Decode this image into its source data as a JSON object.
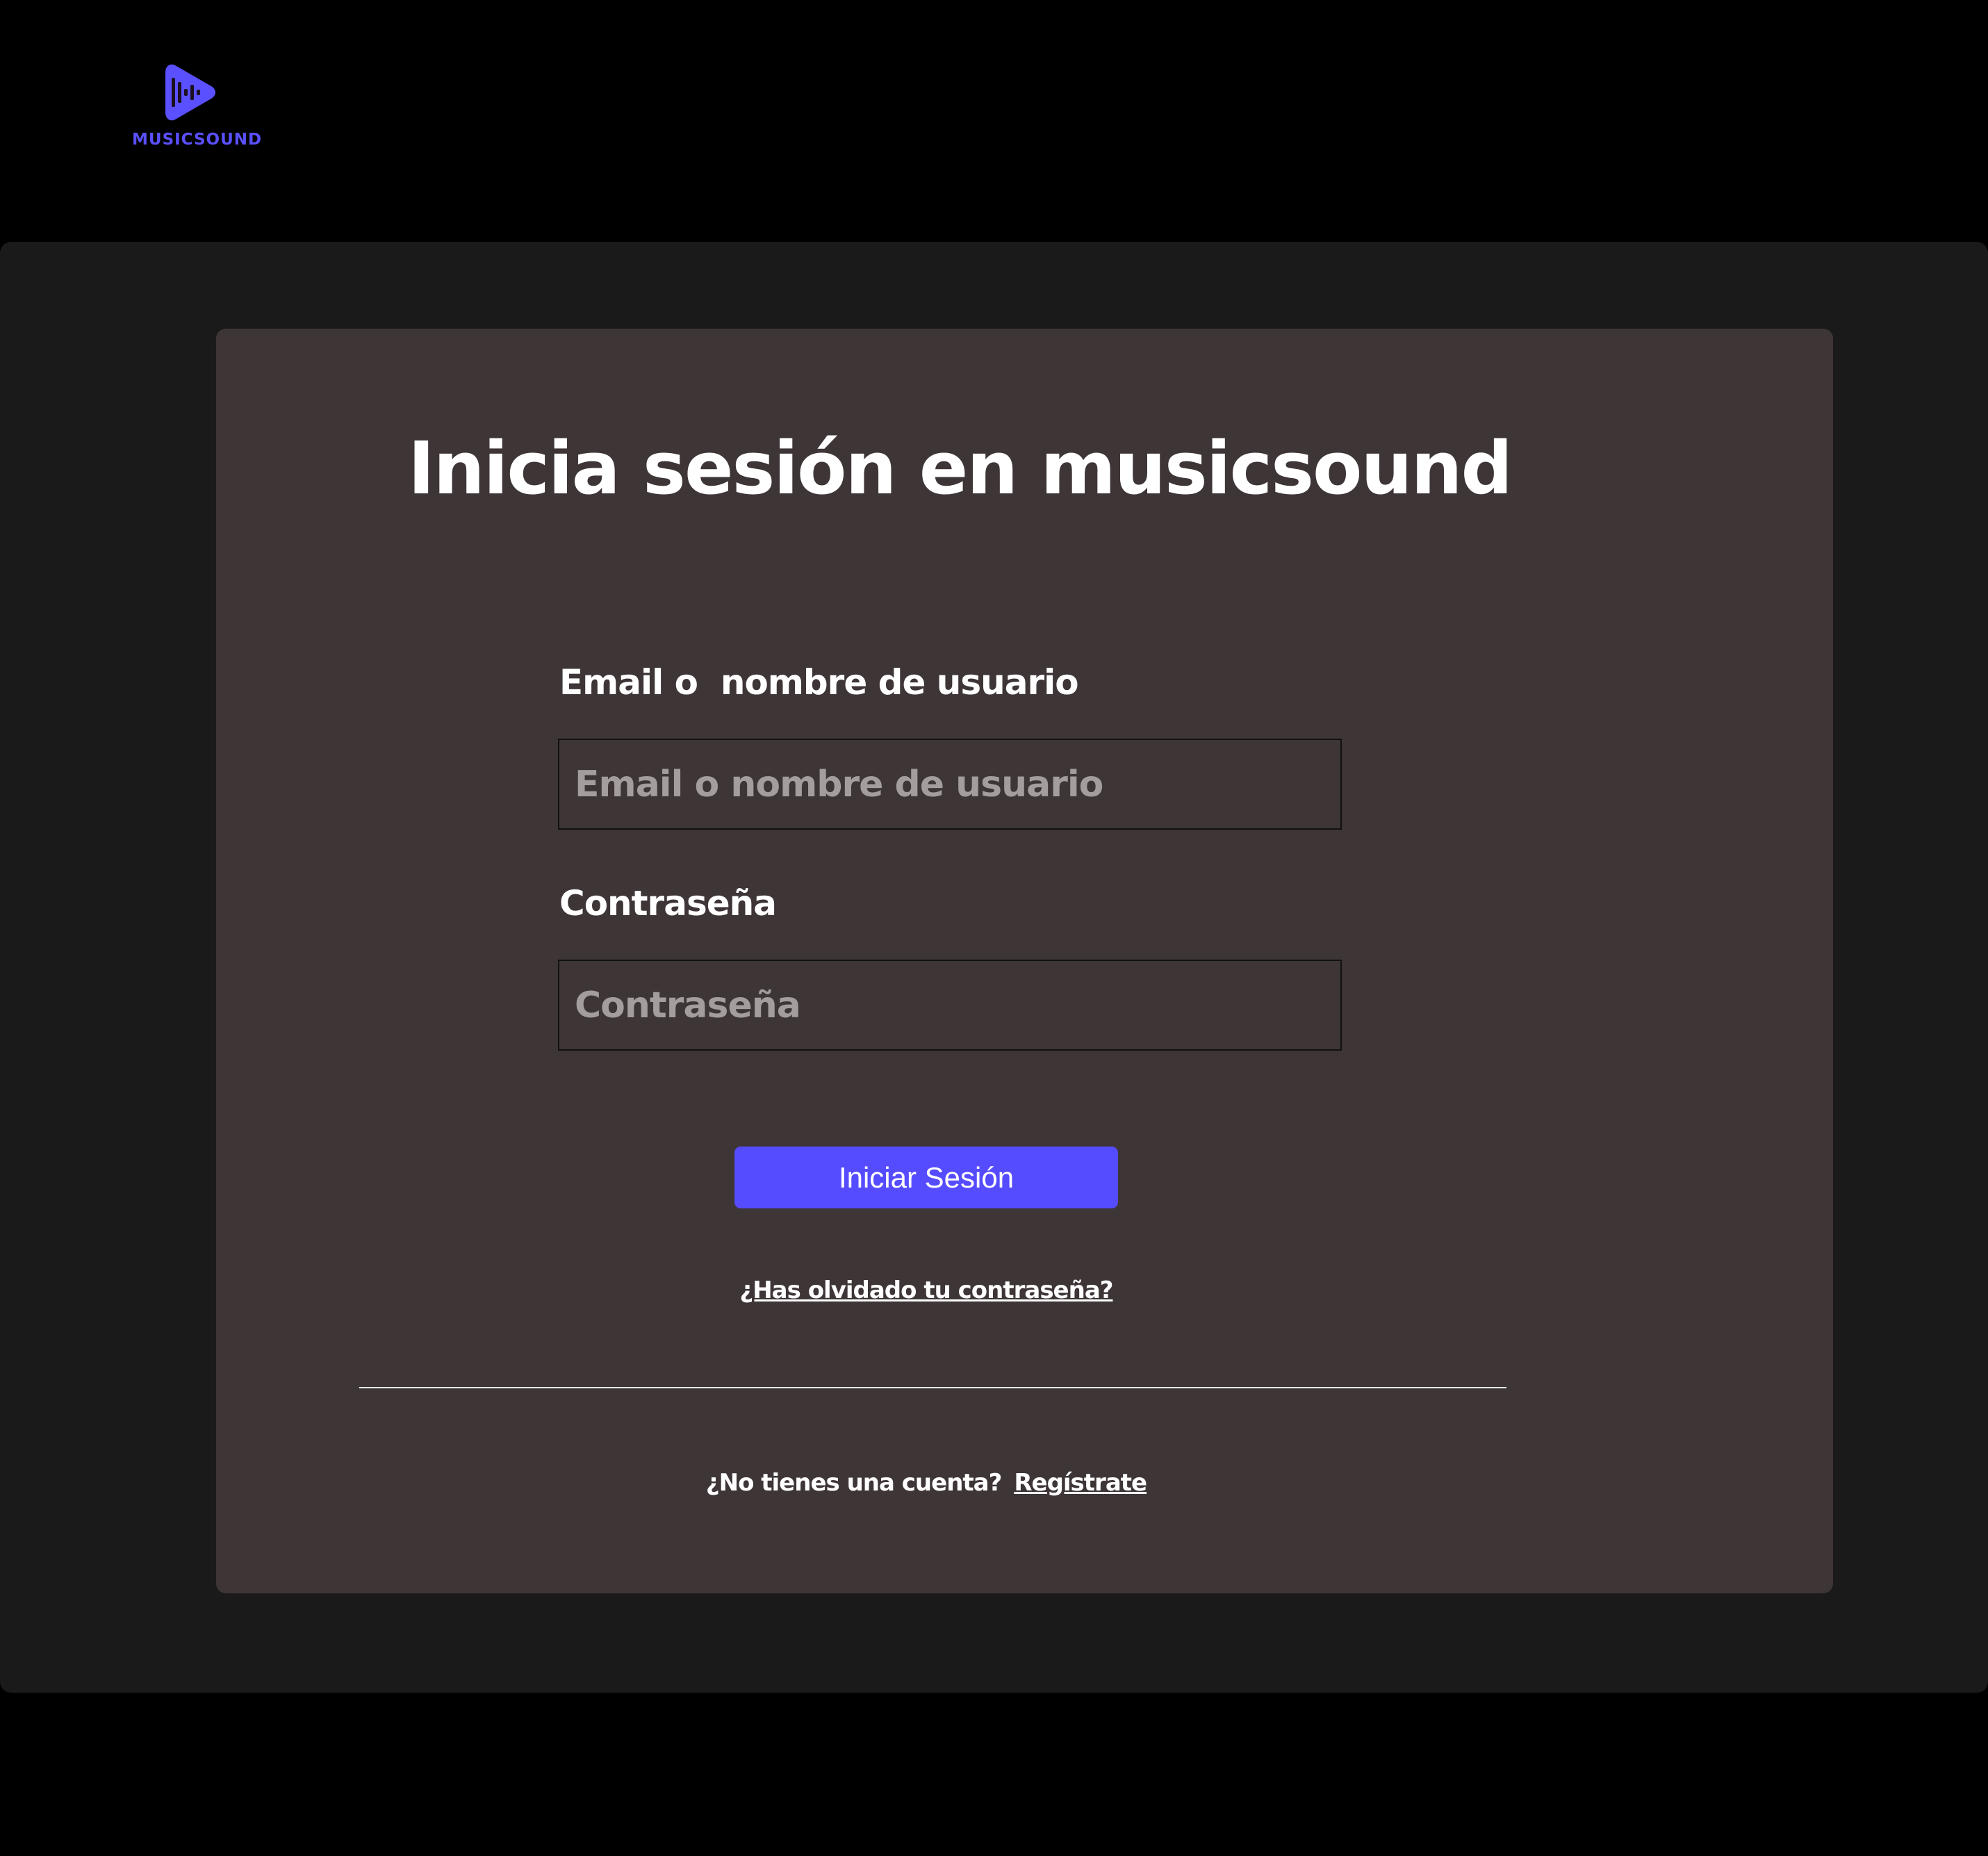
{
  "brand": {
    "logo_icon": "play-soundwave-icon",
    "name": "MUSICSOUND",
    "color": "#5a50ff"
  },
  "login": {
    "title": "Inicia sesión en musicsound",
    "username_label": "Email o  nombre de usuario",
    "username_placeholder": "Email o nombre de usuario",
    "username_value": "",
    "password_label": "Contraseña",
    "password_placeholder": "Contraseña",
    "password_value": "",
    "submit_label": "Iniciar Sesión",
    "forgot_link": "¿Has olvidado tu contraseña?",
    "signup_prompt": "¿No tienes una cuenta?",
    "signup_link": "Regístrate"
  },
  "colors": {
    "page_background": "#000000",
    "outer_panel": "#1a1a1a",
    "card": "#3e3537",
    "accent": "#564cff",
    "text": "#ffffff",
    "placeholder": "#a39d9e"
  }
}
